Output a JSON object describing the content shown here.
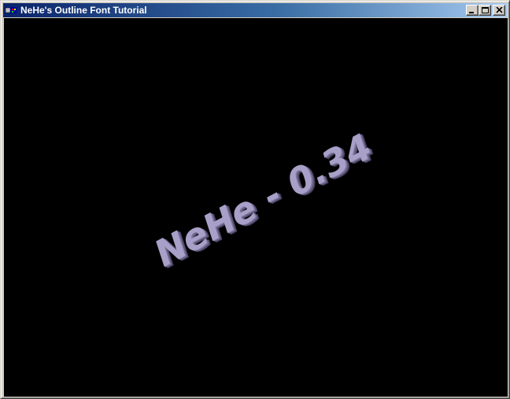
{
  "window": {
    "title": "NeHe's Outline Font Tutorial",
    "buttons": {
      "minimize": "minimize",
      "maximize": "maximize",
      "close": "close"
    }
  },
  "scene": {
    "text": "NeHe - 0.34",
    "text_color": "#a8a0c8",
    "background": "#000000"
  }
}
